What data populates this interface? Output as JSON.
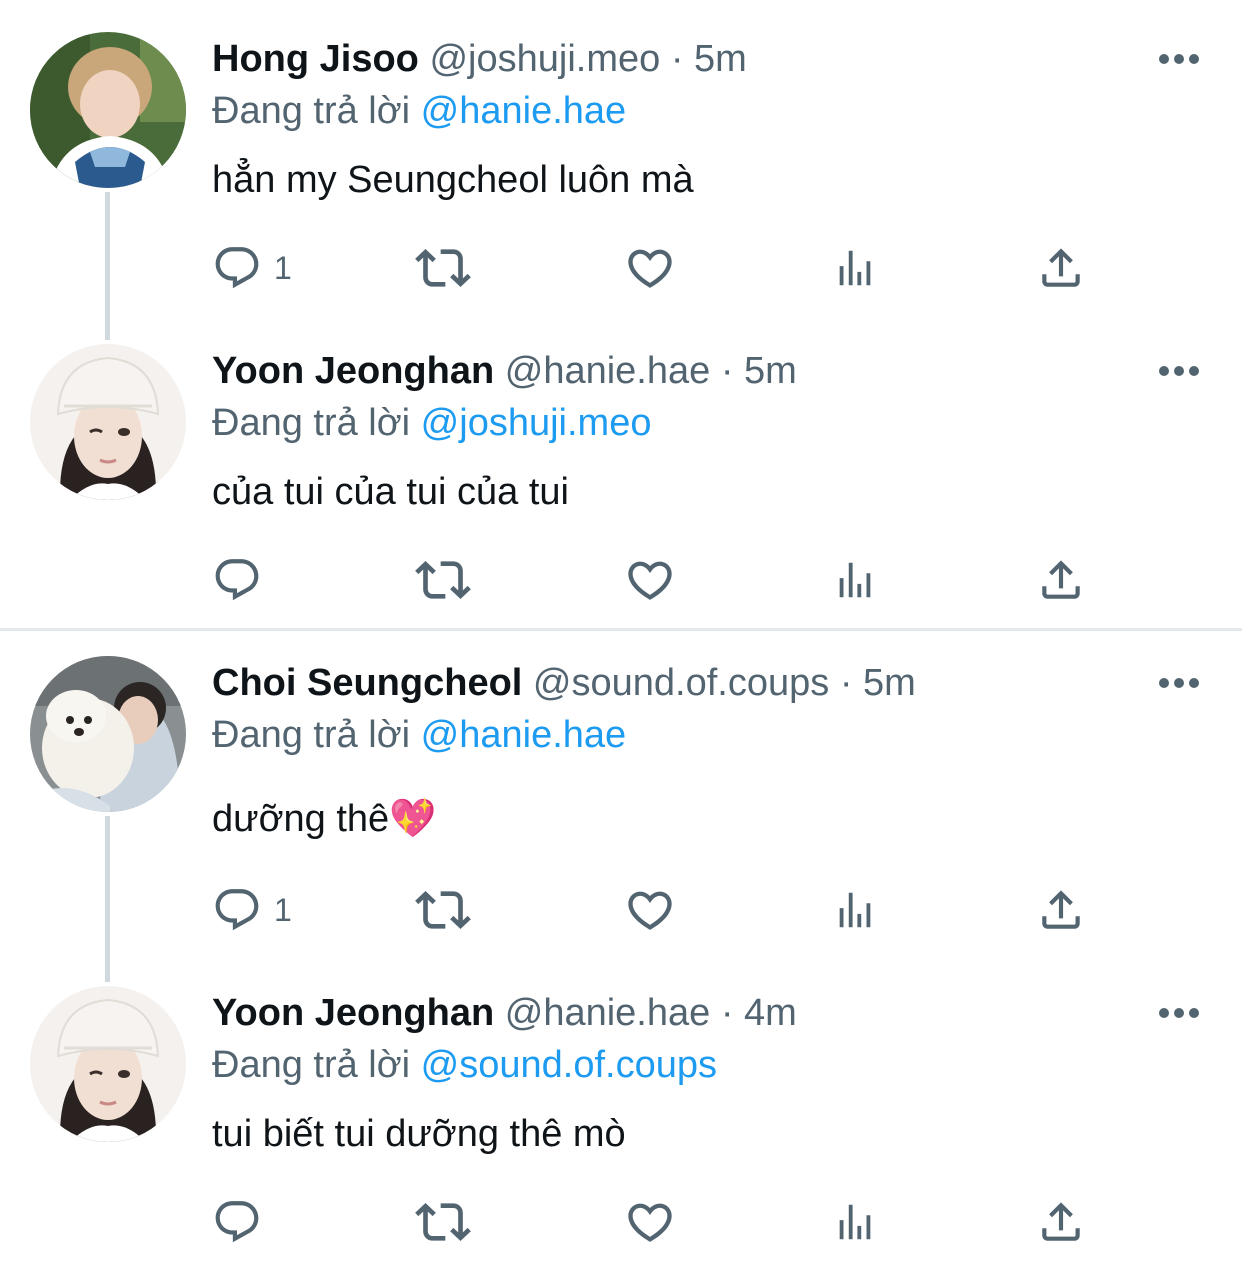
{
  "tweets": [
    {
      "name": "Hong Jisoo",
      "handle": "@joshuji.meo",
      "dot": "·",
      "time": "5m",
      "replying_prefix": "Đang trả lời ",
      "replying_to": "@hanie.hae",
      "text": "hẳn my Seungcheol luôn mà",
      "reply_count": "1",
      "avatar_colors": {
        "bg": "#4a6b3a",
        "hair": "#c9a77a",
        "skin": "#f0d3c0",
        "shirt": "#2b5a8f"
      }
    },
    {
      "name": "Yoon Jeonghan",
      "handle": "@hanie.hae",
      "dot": "·",
      "time": "5m",
      "replying_prefix": "Đang trả lời ",
      "replying_to": "@joshuji.meo",
      "text": "của tui của tui của tui",
      "reply_count": "",
      "avatar_colors": {
        "bg": "#f4f1ee",
        "hat": "#f6f3f0",
        "hair": "#2a2220",
        "skin": "#f2dfd4"
      }
    },
    {
      "name": "Choi Seungcheol",
      "handle": "@sound.of.coups",
      "dot": "·",
      "time": "5m",
      "replying_prefix": "Đang trả lời ",
      "replying_to": "@hanie.hae",
      "text": "dưỡng thê💖",
      "reply_count": "1",
      "avatar_colors": {
        "bg": "#8a8f92",
        "dog": "#f4f1ea",
        "hair": "#2b2624",
        "skin": "#e8cdbd"
      }
    },
    {
      "name": "Yoon Jeonghan",
      "handle": "@hanie.hae",
      "dot": "·",
      "time": "4m",
      "replying_prefix": "Đang trả lời ",
      "replying_to": "@sound.of.coups",
      "text": "tui biết tui dưỡng thê mò",
      "reply_count": "",
      "avatar_colors": {
        "bg": "#f4f1ee",
        "hat": "#f6f3f0",
        "hair": "#2a2220",
        "skin": "#f2dfd4"
      }
    }
  ],
  "icons": {
    "reply": "reply-icon",
    "retweet": "retweet-icon",
    "like": "heart-icon",
    "views": "views-icon",
    "share": "share-icon",
    "more": "more-icon"
  },
  "colors": {
    "text": "#0f1419",
    "secondary": "#536471",
    "link": "#1d9bf0",
    "thread_line": "#cfd9de",
    "divider": "#e6e9eb"
  }
}
